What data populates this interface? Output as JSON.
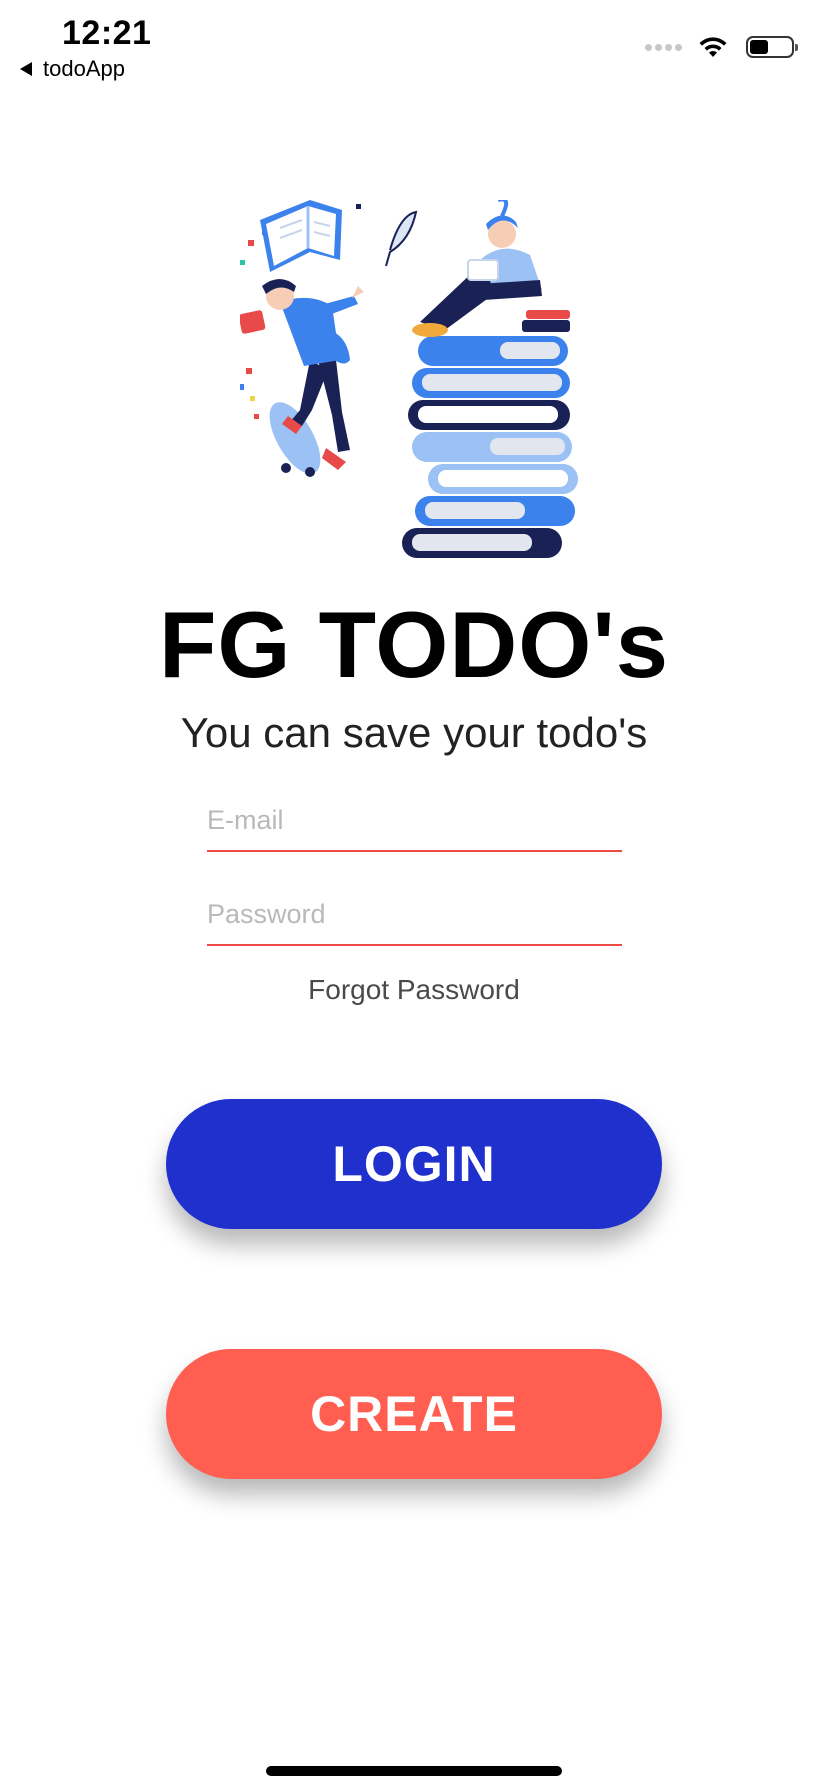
{
  "status_bar": {
    "time": "12:21",
    "back_app": "todoApp",
    "battery_level": 0.45
  },
  "app": {
    "title": "FG TODO's",
    "subtitle": "You can save your todo's"
  },
  "form": {
    "email_placeholder": "E-mail",
    "email_value": "",
    "password_placeholder": "Password",
    "password_value": "",
    "forgot_label": "Forgot Password"
  },
  "buttons": {
    "login_label": "LOGIN",
    "create_label": "CREATE"
  },
  "colors": {
    "login_button": "#1f30cd",
    "create_button": "#ff5e50",
    "input_underline": "#ef4b46",
    "illustration_blue": "#3c82ec",
    "illustration_light_blue": "#9bc1f5",
    "illustration_navy": "#1a2255"
  },
  "icons": {
    "back": "back-chevron-icon",
    "signal": "cellular-signal-icon",
    "wifi": "wifi-icon",
    "battery": "battery-icon"
  }
}
